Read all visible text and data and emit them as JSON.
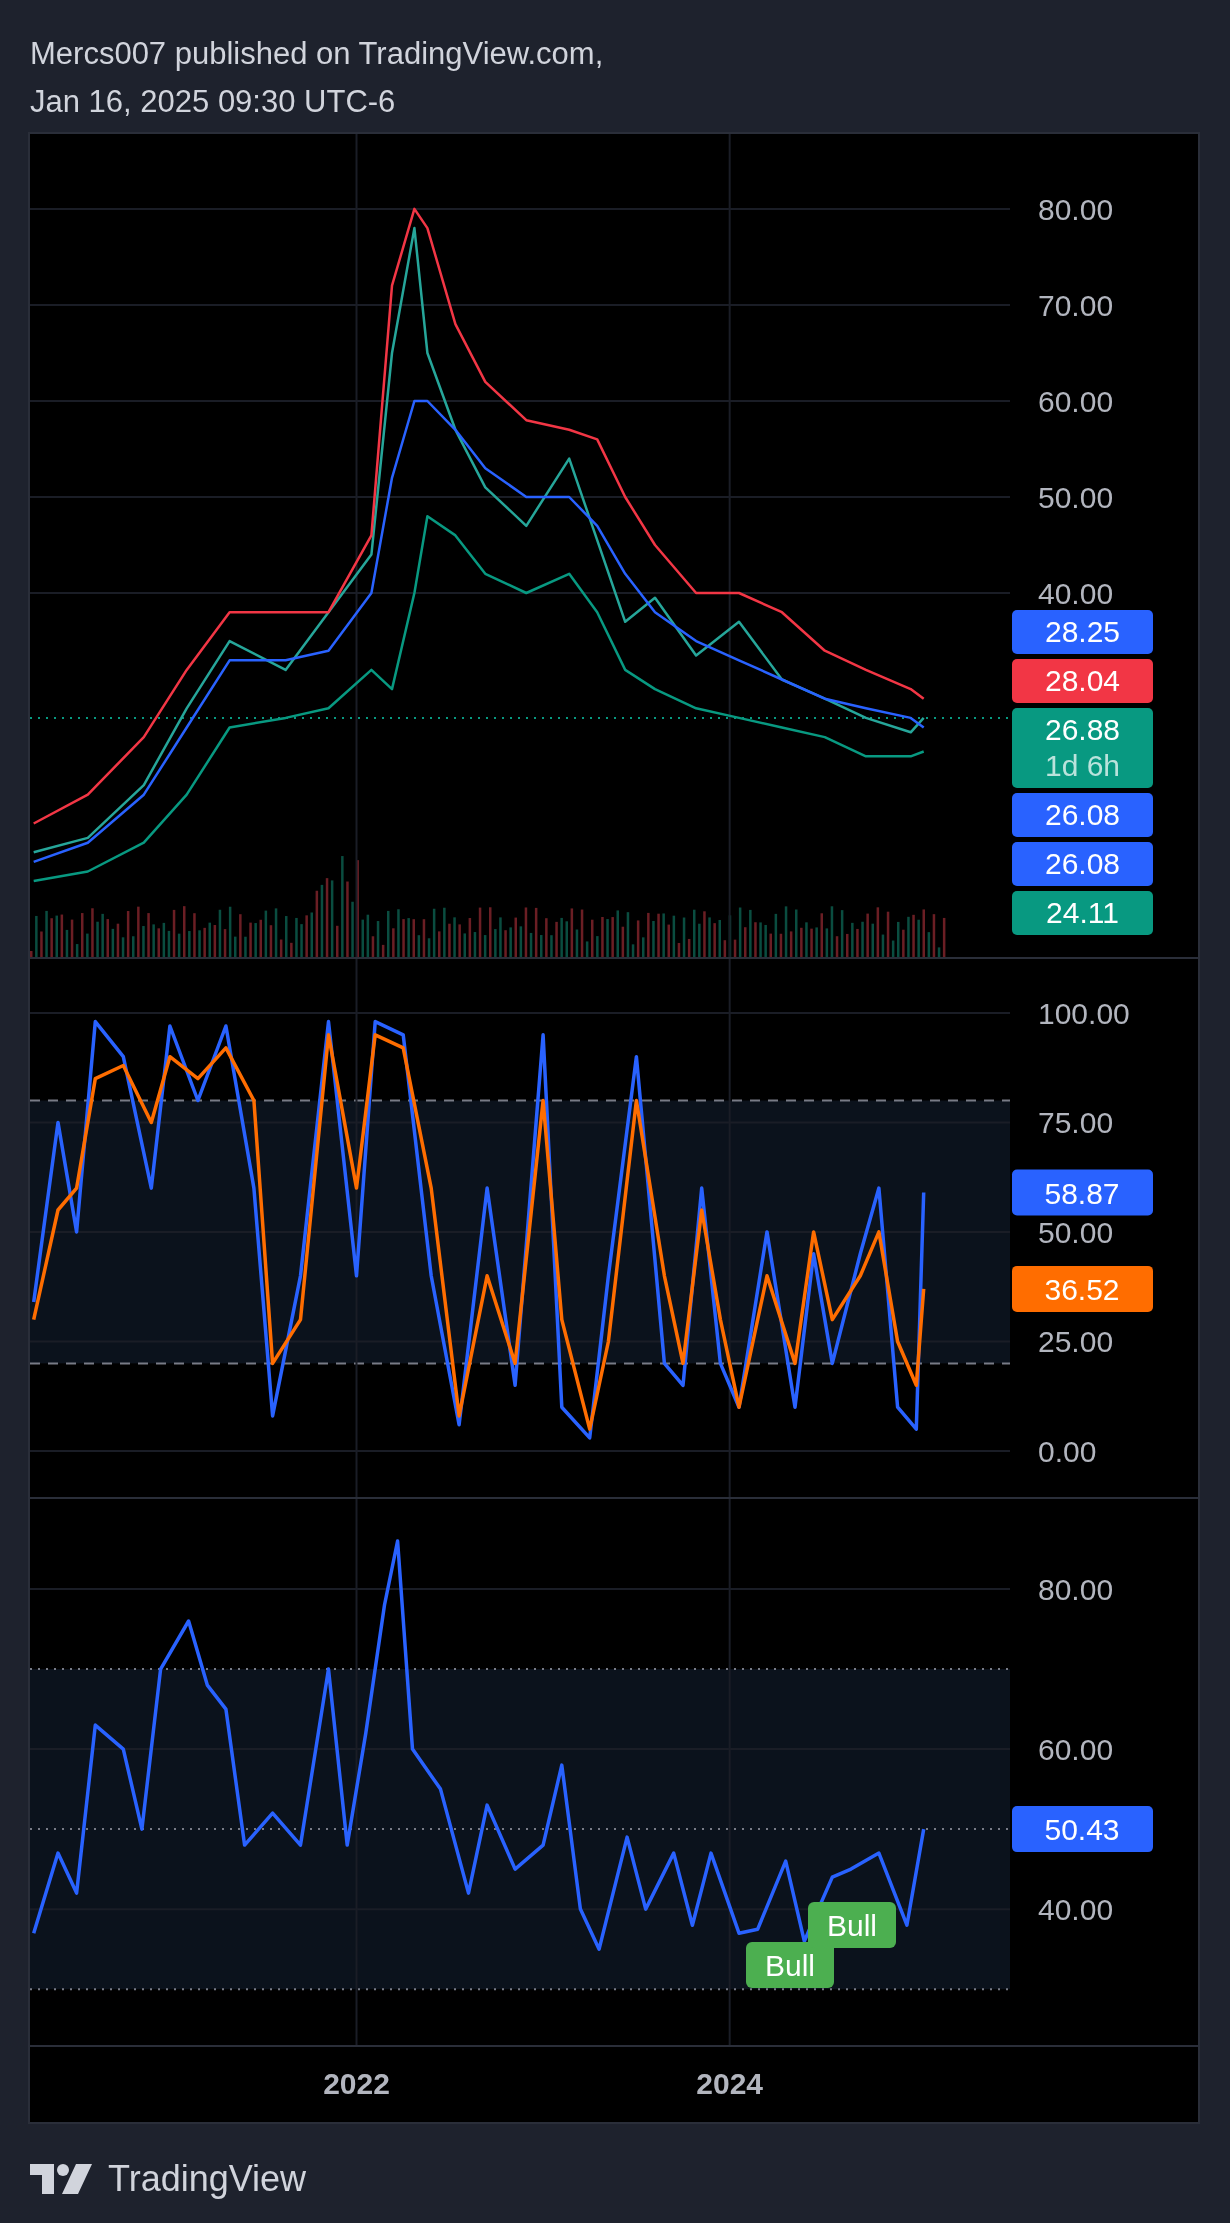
{
  "header": {
    "publisher": "Mercs007 published on TradingView.com,",
    "timestamp": "Jan 16, 2025 09:30 UTC-6"
  },
  "panes": [
    {
      "chart_data": {
        "type": "line",
        "grid": true,
        "x": [
          2020.27,
          2020.56,
          2020.86,
          2021.09,
          2021.32,
          2021.62,
          2021.85,
          2022.08,
          2022.19,
          2022.31,
          2022.38,
          2022.53,
          2022.69,
          2022.91,
          2023.14,
          2023.29,
          2023.44,
          2023.6,
          2023.82,
          2024.05,
          2024.28,
          2024.51,
          2024.73,
          2024.97,
          2025.04
        ],
        "xlim": [
          2020.25,
          2026.51
        ],
        "ylim": [
          2.1,
          87.8
        ],
        "yticks": [
          {
            "value": 40,
            "label": "40.00"
          },
          {
            "value": 50,
            "label": "50.00"
          },
          {
            "value": 60,
            "label": "60.00"
          },
          {
            "value": 70,
            "label": "70.00"
          },
          {
            "value": 80,
            "label": "80.00"
          }
        ],
        "series": [
          {
            "color": "#26a69a",
            "values": [
              13,
              14.5,
              20,
              28,
              35,
              32,
              38,
              44,
              65,
              78,
              65,
              57,
              51,
              47,
              54,
              45.5,
              37,
              39.5,
              33.5,
              37,
              31,
              29,
              27,
              25.5,
              27
            ]
          },
          {
            "color": "#f23645",
            "values": [
              16,
              19,
              25,
              32,
              38,
              38,
              38,
              46,
              72,
              80,
              78,
              68,
              62,
              58,
              57,
              56,
              50,
              45,
              40,
              40,
              38,
              34,
              32,
              30,
              29
            ]
          },
          {
            "color": "#089981",
            "values": [
              10,
              11,
              14,
              19,
              26,
              27,
              28,
              32,
              30,
              40,
              48,
              46,
              42,
              40,
              42,
              38,
              32,
              30,
              28,
              27,
              26,
              25,
              23,
              23,
              23.5
            ]
          },
          {
            "color": "#2962ff",
            "values": [
              12,
              14,
              19,
              26,
              33,
              33,
              34,
              40,
              52,
              60,
              60,
              57,
              53,
              50,
              50,
              47,
              42,
              38,
              35,
              33,
              31,
              29,
              28,
              27,
              26
            ]
          }
        ]
      },
      "price_labels": [
        {
          "text": "28.25",
          "color": "#2962ff"
        },
        {
          "text": "28.04",
          "color": "#f23645"
        },
        {
          "text": "26.88",
          "sub": "1d 6h",
          "color": "#089981"
        },
        {
          "text": "26.08",
          "color": "#2962ff"
        },
        {
          "text": "26.08",
          "color": "#2962ff"
        },
        {
          "text": "24.11",
          "color": "#089981"
        }
      ]
    },
    {
      "chart_data": {
        "type": "line",
        "grid": true,
        "x": [
          2020.27,
          2020.4,
          2020.5,
          2020.6,
          2020.75,
          2020.9,
          2021.0,
          2021.15,
          2021.3,
          2021.45,
          2021.55,
          2021.7,
          2021.85,
          2022.0,
          2022.1,
          2022.25,
          2022.4,
          2022.55,
          2022.7,
          2022.85,
          2023.0,
          2023.1,
          2023.25,
          2023.35,
          2023.5,
          2023.65,
          2023.75,
          2023.85,
          2023.95,
          2024.05,
          2024.2,
          2024.35,
          2024.45,
          2024.55,
          2024.7,
          2024.8,
          2024.9,
          2025.0,
          2025.04
        ],
        "xlim": [
          2020.25,
          2026.51
        ],
        "ylim": [
          -10.5,
          112.3
        ],
        "yticks": [
          {
            "value": 0,
            "label": "0.00"
          },
          {
            "value": 25,
            "label": "25.00"
          },
          {
            "value": 50,
            "label": "50.00"
          },
          {
            "value": 75,
            "label": "75.00"
          },
          {
            "value": 100,
            "label": "100.00"
          }
        ],
        "series": [
          {
            "color": "#2962ff",
            "values": [
              34,
              75,
              50,
              98,
              90,
              60,
              97,
              80,
              97,
              60,
              8,
              40,
              98,
              40,
              98,
              95,
              40,
              6,
              60,
              15,
              95,
              10,
              3,
              40,
              90,
              20,
              15,
              60,
              20,
              10,
              50,
              10,
              45,
              20,
              45,
              60,
              10,
              5,
              59
            ]
          },
          {
            "color": "#ff6d00",
            "values": [
              30,
              55,
              60,
              85,
              88,
              75,
              90,
              85,
              92,
              80,
              20,
              30,
              95,
              60,
              95,
              92,
              60,
              8,
              40,
              20,
              80,
              30,
              5,
              25,
              80,
              40,
              20,
              55,
              30,
              10,
              40,
              20,
              50,
              30,
              40,
              50,
              25,
              15,
              37
            ]
          }
        ]
      },
      "value_labels": [
        "58.87",
        "36.52"
      ]
    },
    {
      "chart_data": {
        "type": "line",
        "grid": true,
        "x": [
          2020.27,
          2020.4,
          2020.5,
          2020.6,
          2020.75,
          2020.85,
          2020.95,
          2021.1,
          2021.2,
          2021.3,
          2021.4,
          2021.55,
          2021.7,
          2021.85,
          2021.95,
          2022.05,
          2022.15,
          2022.22,
          2022.3,
          2022.45,
          2022.6,
          2022.7,
          2022.85,
          2023.0,
          2023.1,
          2023.2,
          2023.3,
          2023.45,
          2023.55,
          2023.7,
          2023.8,
          2023.9,
          2024.05,
          2024.15,
          2024.3,
          2024.4,
          2024.55,
          2024.65,
          2024.8,
          2024.95,
          2025.04
        ],
        "xlim": [
          2020.25,
          2026.51
        ],
        "ylim": [
          22.9,
          91.25
        ],
        "xticks": [
          {
            "value": 2022,
            "label": "2022"
          },
          {
            "value": 2024,
            "label": "2024"
          }
        ],
        "yticks": [
          {
            "value": 40,
            "label": "40.00"
          },
          {
            "value": 60,
            "label": "60.00"
          },
          {
            "value": 80,
            "label": "80.00"
          }
        ],
        "series": [
          {
            "color": "#2962ff",
            "values": [
              37,
              47,
              42,
              63,
              60,
              50,
              70,
              76,
              68,
              65,
              48,
              52,
              48,
              70,
              48,
              62,
              78,
              86,
              60,
              55,
              42,
              53,
              45,
              48,
              58,
              40,
              35,
              49,
              40,
              47,
              38,
              47,
              37,
              37.5,
              46,
              36,
              44,
              45,
              47,
              38,
              50
            ]
          }
        ],
        "annotations": [
          "Bull",
          "Bull"
        ]
      },
      "value_labels": [
        "50.43"
      ]
    }
  ],
  "footer": {
    "brand": "TradingView"
  }
}
